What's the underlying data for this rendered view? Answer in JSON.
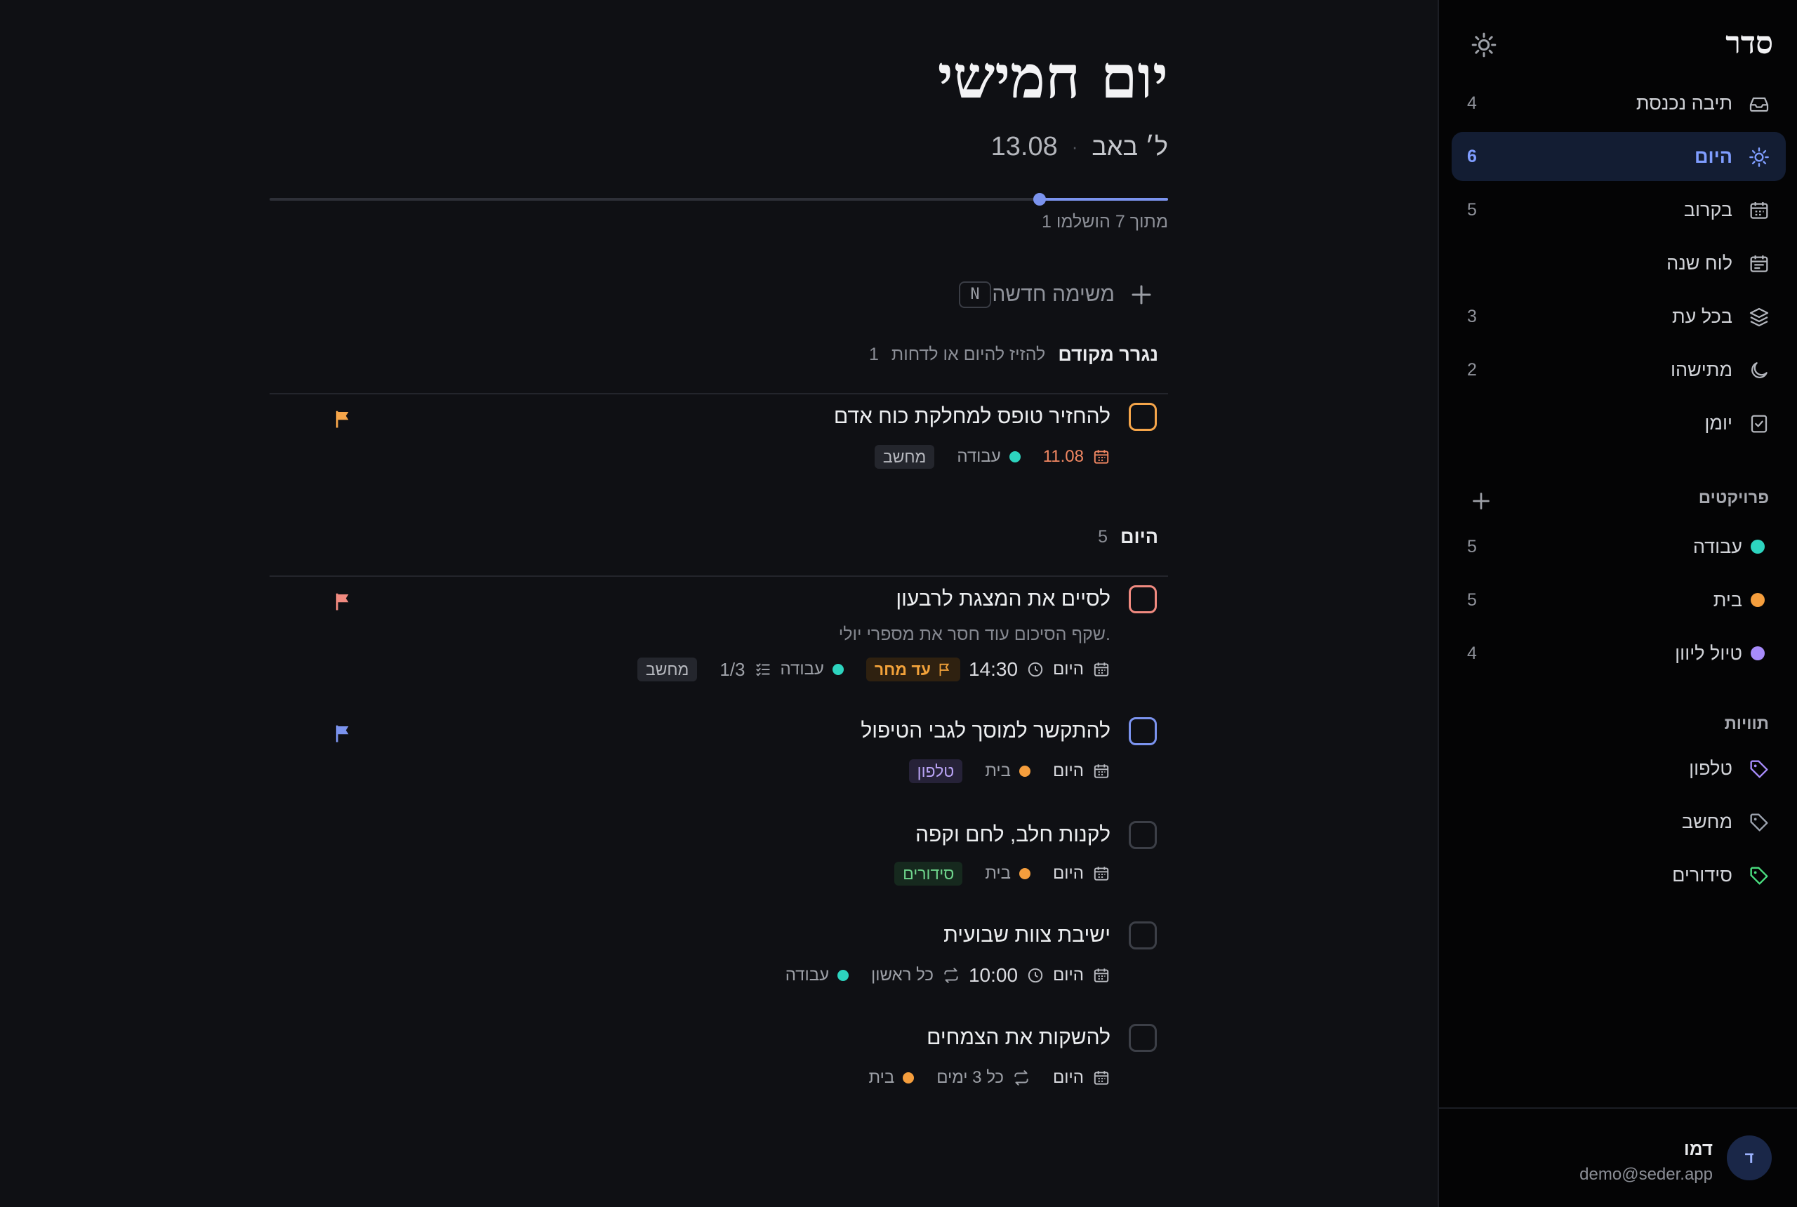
{
  "sidebar": {
    "brand": "סדר",
    "nav": [
      {
        "label": "תיבה נכנסת",
        "count": "4",
        "icon": "inbox-icon"
      },
      {
        "label": "היום",
        "count": "6",
        "icon": "sun-icon",
        "active": true
      },
      {
        "label": "בקרוב",
        "count": "5",
        "icon": "calendar-icon"
      },
      {
        "label": "לוח שנה",
        "count": "",
        "icon": "calendar-grid-icon"
      },
      {
        "label": "בכל עת",
        "count": "3",
        "icon": "layers-icon"
      },
      {
        "label": "מתישהו",
        "count": "2",
        "icon": "moon-icon"
      },
      {
        "label": "יומן",
        "count": "",
        "icon": "journal-icon"
      }
    ],
    "projects_title": "פרויקטים",
    "projects": [
      {
        "label": "עבודה",
        "count": "5",
        "color": "#2dd4bf"
      },
      {
        "label": "בית",
        "count": "5",
        "color": "#f59e3d"
      },
      {
        "label": "טיול ליוון",
        "count": "4",
        "color": "#a78bfa"
      }
    ],
    "tags_title": "תוויות",
    "tags": [
      {
        "label": "טלפון",
        "color": "#a78bfa"
      },
      {
        "label": "מחשב",
        "color": "#9ca3af"
      },
      {
        "label": "סידורים",
        "color": "#4ade80"
      }
    ],
    "user": {
      "initial": "ד",
      "name": "דמו",
      "email": "demo@seder.app"
    }
  },
  "header": {
    "title": "יום חמישי",
    "hebrew_date": "ל׳ באב",
    "separator": "·",
    "date": "13.08",
    "progress_text": "1 מתוך 7 הושלמו",
    "progress_fraction": 0.143
  },
  "new_task": {
    "label": "משימה חדשה",
    "shortcut": "N"
  },
  "overdue_section": {
    "title": "נגרר מקודם",
    "hint": "להזיז להיום או לדחות",
    "count": "1"
  },
  "today_section": {
    "title": "היום",
    "count": "5"
  },
  "tasks": {
    "t1": {
      "title": "להחזיר טופס למחלקת כוח אדם",
      "date": "11.08",
      "project": "עבודה",
      "tag": "מחשב",
      "priority_color": "#f5a54a"
    },
    "t2": {
      "title": "לסיים את המצגת לרבעון",
      "note": "שקף הסיכום עוד חסר את מספרי יולי.",
      "date": "היום",
      "time": "14:30",
      "deadline": "עד מחר",
      "project": "עבודה",
      "checklist": "1/3",
      "tag": "מחשב",
      "priority_color": "#f08a80"
    },
    "t3": {
      "title": "להתקשר למוסך לגבי הטיפול",
      "date": "היום",
      "project": "בית",
      "tag": "טלפון",
      "priority_color": "#7b93ee"
    },
    "t4": {
      "title": "לקנות חלב, לחם וקפה",
      "date": "היום",
      "project": "בית",
      "tag": "סידורים"
    },
    "t5": {
      "title": "ישיבת צוות שבועית",
      "date": "היום",
      "time": "10:00",
      "repeat": "כל ראשון",
      "project": "עבודה"
    },
    "t6": {
      "title": "להשקות את הצמחים",
      "date": "היום",
      "repeat": "כל 3 ימים",
      "project": "בית"
    }
  },
  "colors": {
    "accent": "#7b93ee",
    "work": "#2dd4bf",
    "home": "#f59e3d",
    "trip": "#a78bfa",
    "overdue": "#f08762"
  }
}
